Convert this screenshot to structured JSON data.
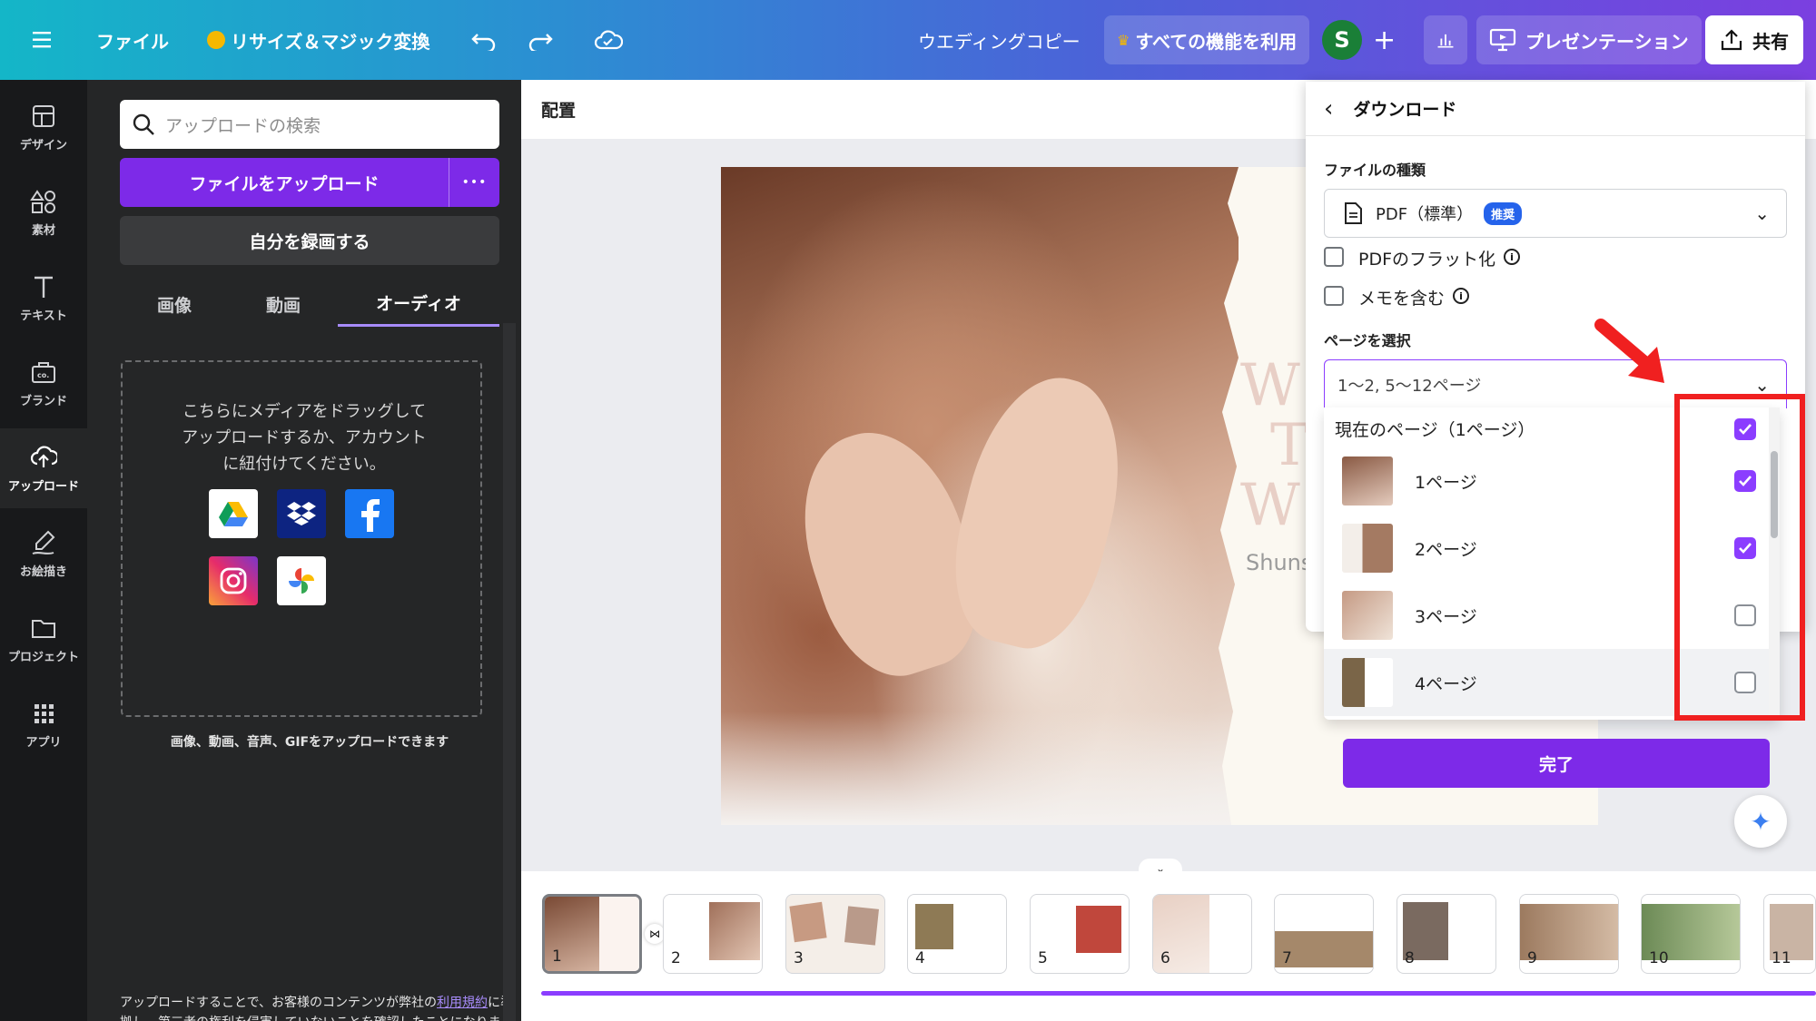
{
  "topbar": {
    "menu_icon": "hamburger-icon",
    "file": "ファイル",
    "resize": "リサイズ＆マジック変換",
    "undo_icon": "undo-icon",
    "redo_icon": "redo-icon",
    "cloud_icon": "cloud-saved-icon",
    "doc_title": "ウエディングコピー",
    "all_features": "すべての機能を利用",
    "avatar_initial": "S",
    "present": "プレゼンテーション",
    "share": "共有"
  },
  "leftnav": {
    "items": [
      {
        "label": "デザイン",
        "icon": "design-icon"
      },
      {
        "label": "素材",
        "icon": "elements-icon"
      },
      {
        "label": "テキスト",
        "icon": "text-icon"
      },
      {
        "label": "ブランド",
        "icon": "brand-icon"
      },
      {
        "label": "アップロード",
        "icon": "upload-icon"
      },
      {
        "label": "お絵描き",
        "icon": "draw-icon"
      },
      {
        "label": "プロジェクト",
        "icon": "folder-icon"
      },
      {
        "label": "アプリ",
        "icon": "apps-icon"
      }
    ]
  },
  "panel": {
    "search_placeholder": "アップロードの検索",
    "upload_button": "ファイルをアップロード",
    "more_dots": "•••",
    "record_button": "自分を録画する",
    "tabs": [
      "画像",
      "動画",
      "オーディオ"
    ],
    "dropzone_text": "こちらにメディアをドラッグしてアップロードするか、アカウントに紐付けてください。",
    "services": [
      "google-drive-icon",
      "dropbox-icon",
      "facebook-icon",
      "instagram-icon",
      "google-photos-icon"
    ],
    "supported_text": "画像、動画、音声、GIFをアップロードできます",
    "footer_text_1": "アップロードすることで、お客様のコンテンツが弊社の",
    "footer_link": "利用規約",
    "footer_text_2": "に準拠し、第三者の権利を侵害していないことを確認したことになりま"
  },
  "canvas": {
    "arrange_label": "配置",
    "slide_text_1": "W",
    "slide_text_2": "T",
    "slide_text_3": "W",
    "slide_subtitle": "Shuns"
  },
  "download": {
    "title": "ダウンロード",
    "file_type_label": "ファイルの種類",
    "file_type_value": "PDF（標準）",
    "recommended_badge": "推奨",
    "flatten_pdf": "PDFのフラット化",
    "include_notes": "メモを含む",
    "select_pages_label": "ページを選択",
    "pages_value": "1〜2, 5〜12ページ",
    "page_options": [
      {
        "label": "現在のページ（1ページ）",
        "checked": true,
        "thumb": false
      },
      {
        "label": "1ページ",
        "checked": true,
        "thumb": true
      },
      {
        "label": "2ページ",
        "checked": true,
        "thumb": true
      },
      {
        "label": "3ページ",
        "checked": false,
        "thumb": true
      },
      {
        "label": "4ページ",
        "checked": false,
        "thumb": true
      }
    ],
    "done_button": "完了"
  },
  "filmstrip": {
    "pages": [
      "1",
      "2",
      "3",
      "4",
      "5",
      "6",
      "7",
      "8",
      "9",
      "10",
      "11"
    ]
  },
  "colors": {
    "accent": "#7d2ae8",
    "checkbox": "#8b3dff",
    "annotation": "#f02020"
  }
}
